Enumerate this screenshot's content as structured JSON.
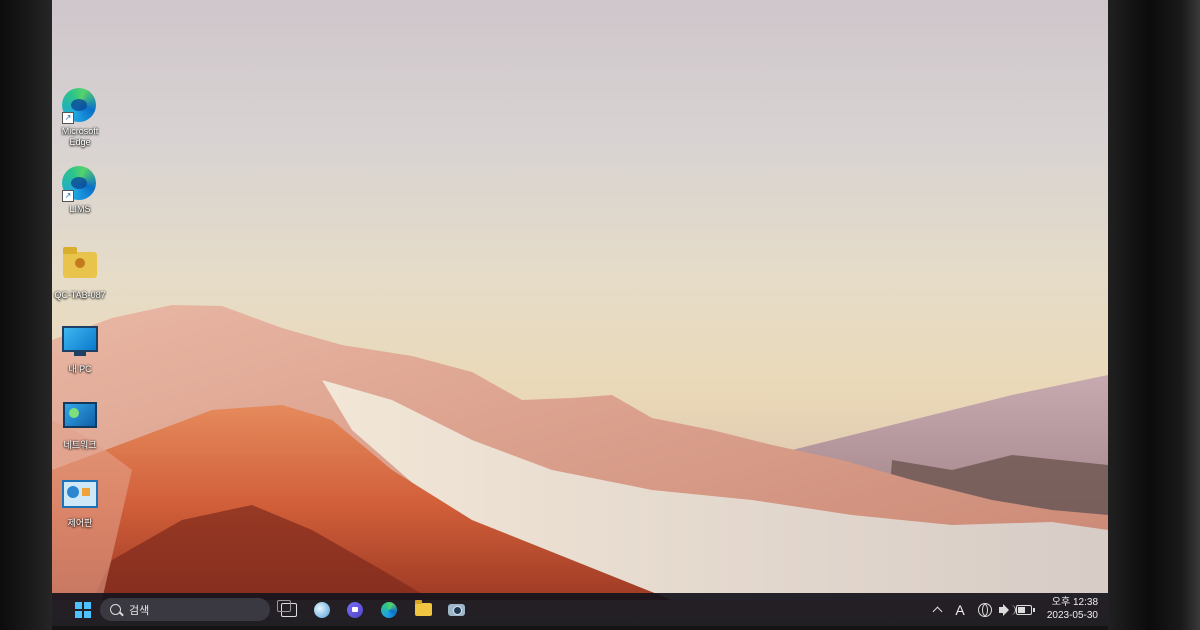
{
  "desktop": {
    "icons": [
      {
        "label": "Microsoft Edge",
        "icon": "edge-icon"
      },
      {
        "label": "LIMS",
        "icon": "edge-icon"
      },
      {
        "label": "QC-TAB-087",
        "icon": "user-folder-icon"
      },
      {
        "label": "내 PC",
        "icon": "monitor-icon"
      },
      {
        "label": "네트워크",
        "icon": "network-icon"
      },
      {
        "label": "제어판",
        "icon": "control-panel-icon"
      }
    ]
  },
  "taskbar": {
    "search_label": "검색",
    "pinned": [
      "task-view-icon",
      "widgets-icon",
      "meet-icon",
      "edge-icon",
      "file-explorer-icon",
      "camera-icon"
    ],
    "tray": {
      "ime_indicator": "A",
      "time": "오후 12:38",
      "date": "2023-05-30"
    }
  },
  "colors": {
    "taskbar_bg": "#16141c",
    "windows_blue": "#4cc2ff",
    "sky_top": "#cfc6cb",
    "sky_bottom": "#ead9b8",
    "mountain_orange": "#d2603a"
  }
}
